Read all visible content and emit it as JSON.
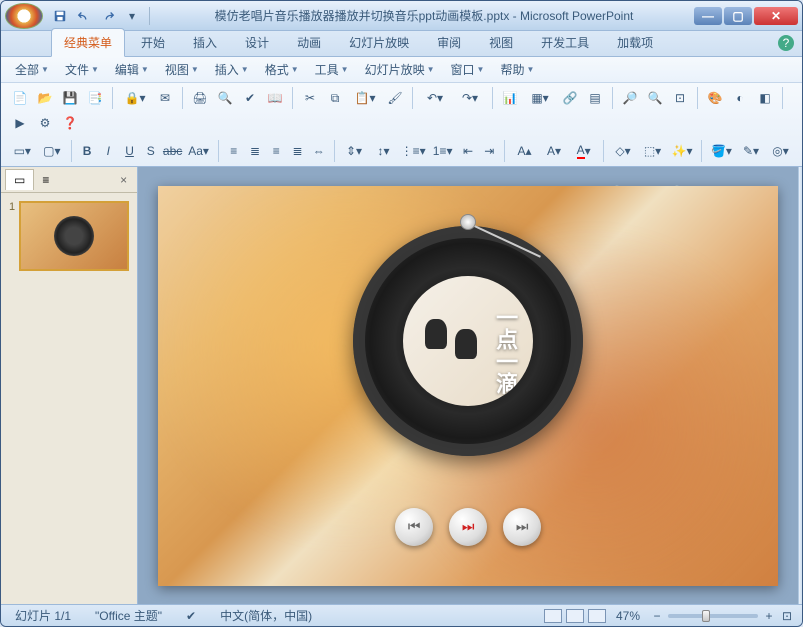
{
  "title": "模仿老唱片音乐播放器播放并切换音乐ppt动画模板.pptx - Microsoft PowerPoint",
  "tabs": {
    "t0": "经典菜单",
    "t1": "开始",
    "t2": "插入",
    "t3": "设计",
    "t4": "动画",
    "t5": "幻灯片放映",
    "t6": "审阅",
    "t7": "视图",
    "t8": "开发工具",
    "t9": "加载项"
  },
  "menus": {
    "m0": "全部",
    "m1": "文件",
    "m2": "编辑",
    "m3": "视图",
    "m4": "插入",
    "m5": "格式",
    "m6": "工具",
    "m7": "幻灯片放映",
    "m8": "窗口",
    "m9": "帮助"
  },
  "panel": {
    "tab_slides": "",
    "tab_outline": "",
    "close": "×",
    "num": "1"
  },
  "album_text": "一点一滴",
  "status": {
    "slide": "幻灯片 1/1",
    "theme": "\"Office 主题\"",
    "lang": "中文(简体，中国)",
    "zoom": "47%"
  }
}
